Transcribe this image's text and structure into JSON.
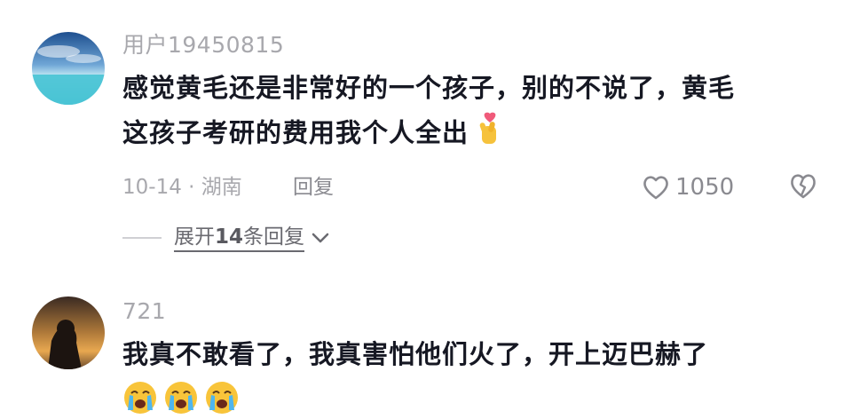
{
  "comments": [
    {
      "username": "用户19450815",
      "text_line1": "感觉黄毛还是非常好的一个孩子，别的不说了，黄毛",
      "text_line2": "这孩子考研的费用我个人全出",
      "emoji": "finger-heart-emoji",
      "date_location": "10-14 · 湖南",
      "reply_label": "回复",
      "like_count": "1050"
    },
    {
      "username": "721",
      "text_line1": "我真不敢看了，我真害怕他们火了，开上迈巴赫了",
      "emojis": [
        "crying-face-emoji",
        "crying-face-emoji",
        "crying-face-emoji"
      ]
    }
  ],
  "expand_replies": {
    "prefix": "展开",
    "count": "14",
    "suffix": "条回复"
  },
  "colors": {
    "text": "#161823",
    "muted": "#a8a8ad"
  }
}
